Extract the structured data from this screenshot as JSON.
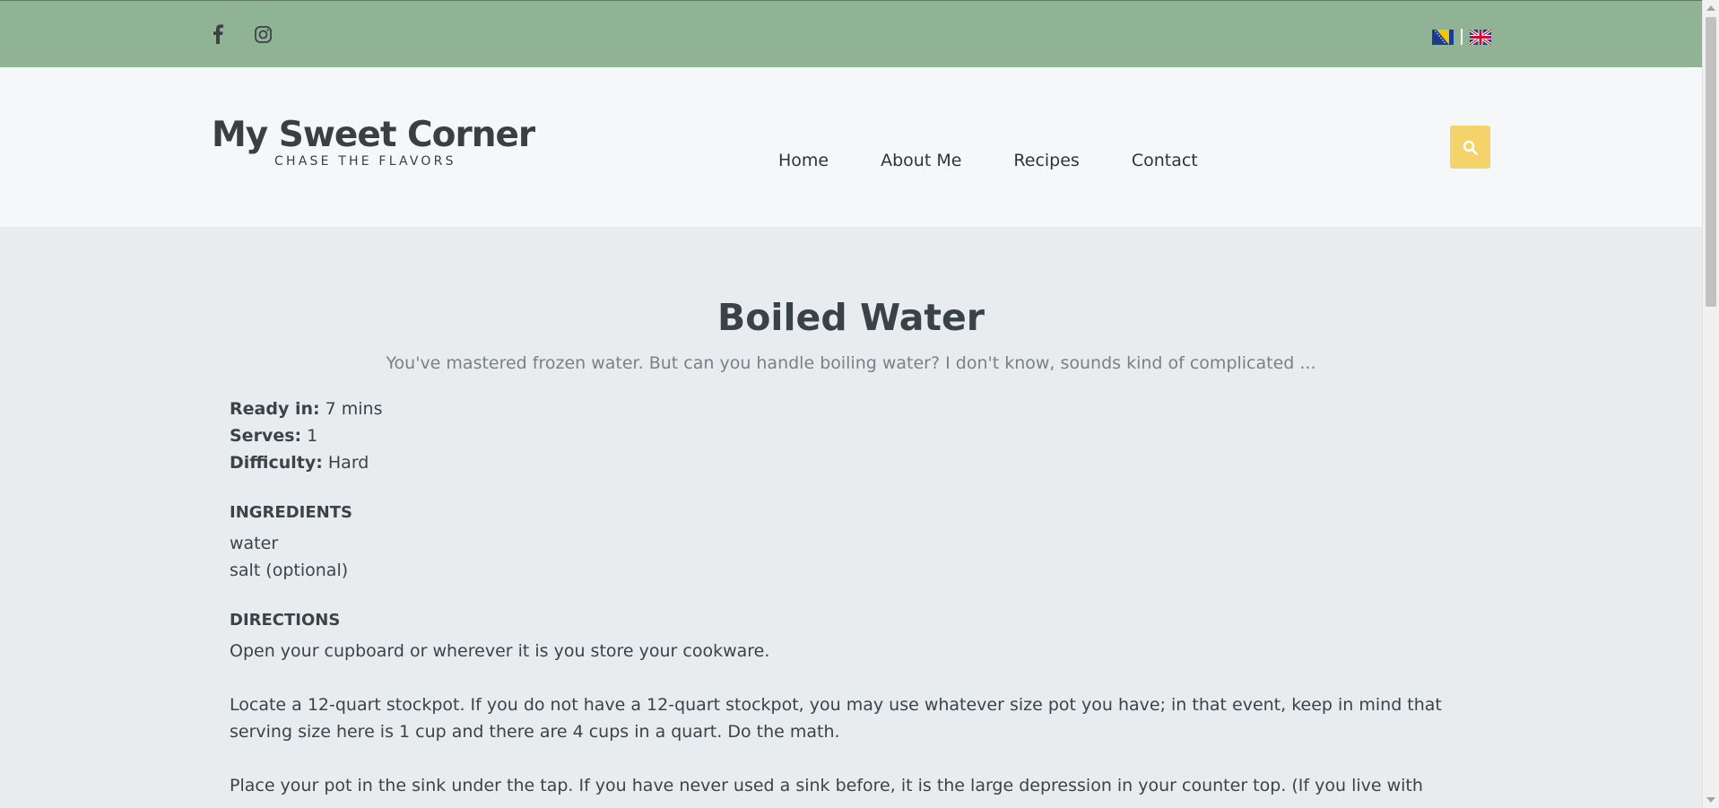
{
  "topbar": {
    "social": [
      {
        "icon": "facebook-icon"
      },
      {
        "icon": "instagram-icon"
      }
    ],
    "languages": [
      {
        "icon": "bosnia-flag-icon"
      },
      {
        "icon": "uk-flag-icon"
      }
    ],
    "background": "#8fb394"
  },
  "header": {
    "logo_title": "My Sweet Corner",
    "logo_tagline": "CHASE THE FLAVORS",
    "nav": [
      "Home",
      "About Me",
      "Recipes",
      "Contact"
    ],
    "search_icon": "search-icon",
    "search_color": "#f4d46a"
  },
  "recipe": {
    "title": "Boiled Water",
    "subtitle": "You've mastered frozen water. But can you handle boiling water? I don't know, sounds kind of complicated ...",
    "meta": [
      {
        "label": "Ready in:",
        "value": "7 mins"
      },
      {
        "label": "Serves:",
        "value": "1"
      },
      {
        "label": "Difficulty:",
        "value": "Hard"
      }
    ],
    "ingredients_heading": "INGREDIENTS",
    "ingredients": [
      "water",
      "salt (optional)"
    ],
    "directions_heading": "DIRECTIONS",
    "directions": [
      "Open your cupboard or wherever it is you store your cookware.",
      "Locate a 12-quart stockpot. If you do not have a 12-quart stockpot, you may use whatever size pot you have; in that event, keep in mind that serving size here is 1 cup and there are 4 cups in a quart. Do the math.",
      "Place your pot in the sink under the tap. If you have never used a sink before, it is the large depression in your counter top. (If you live with"
    ]
  }
}
